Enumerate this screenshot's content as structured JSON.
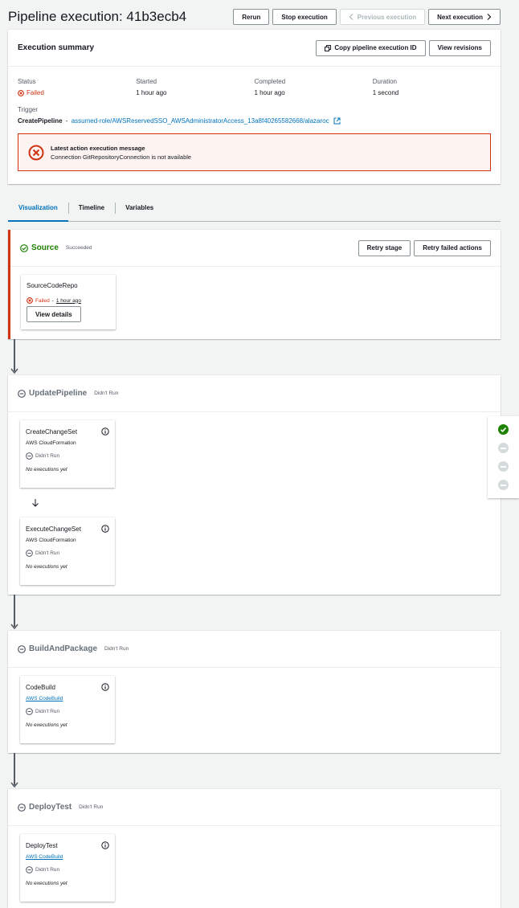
{
  "header": {
    "title": "Pipeline execution: 41b3ecb4",
    "rerun": "Rerun",
    "stop": "Stop execution",
    "previous": "Previous execution",
    "next": "Next execution"
  },
  "summary": {
    "title": "Execution summary",
    "copy_id": "Copy pipeline execution ID",
    "view_revisions": "View revisions",
    "status_label": "Status",
    "status_value": "Failed",
    "started_label": "Started",
    "started_value": "1 hour ago",
    "completed_label": "Completed",
    "completed_value": "1 hour ago",
    "duration_label": "Duration",
    "duration_value": "1 second",
    "trigger_label": "Trigger",
    "trigger_name": "CreatePipeline",
    "trigger_sep": " - ",
    "trigger_link": "assumed-role/AWSReservedSSO_AWSAdministratorAccess_13a8f40265582668/alazaroc",
    "alert_title": "Latest action execution message",
    "alert_body": "Connection GitRepositoryConnection is not available"
  },
  "tabs": [
    {
      "label": "Visualization"
    },
    {
      "label": "Timeline"
    },
    {
      "label": "Variables"
    }
  ],
  "stages": [
    {
      "name": "Source",
      "status": "Succeeded",
      "retry_stage": "Retry stage",
      "retry_failed": "Retry failed actions",
      "actions": [
        {
          "name": "SourceCodeRepo",
          "status": "Failed",
          "sep": "-",
          "time": "1 hour ago",
          "view_details": "View details"
        }
      ]
    },
    {
      "name": "UpdatePipeline",
      "status": "Didn't Run",
      "actions": [
        {
          "name": "CreateChangeSet",
          "provider": "AWS CloudFormation",
          "status": "Didn't Run",
          "note": "No executions yet"
        },
        {
          "name": "ExecuteChangeSet",
          "provider": "AWS CloudFormation",
          "status": "Didn't Run",
          "note": "No executions yet"
        }
      ]
    },
    {
      "name": "BuildAndPackage",
      "status": "Didn't Run",
      "actions": [
        {
          "name": "CodeBuild",
          "provider": "AWS CodeBuild",
          "status": "Didn't Run",
          "note": "No executions yet"
        }
      ]
    },
    {
      "name": "DeployTest",
      "status": "Didn't Run",
      "actions": [
        {
          "name": "DeployTest",
          "provider": "AWS CodeBuild",
          "status": "Didn't Run",
          "note": "No executions yet"
        }
      ]
    }
  ],
  "sidebar": {
    "indicators": [
      "success",
      "not-run",
      "not-run",
      "not-run"
    ]
  },
  "colors": {
    "error": "#d13212",
    "success": "#1d8102",
    "link": "#0073bb",
    "neutral": "#687078"
  }
}
